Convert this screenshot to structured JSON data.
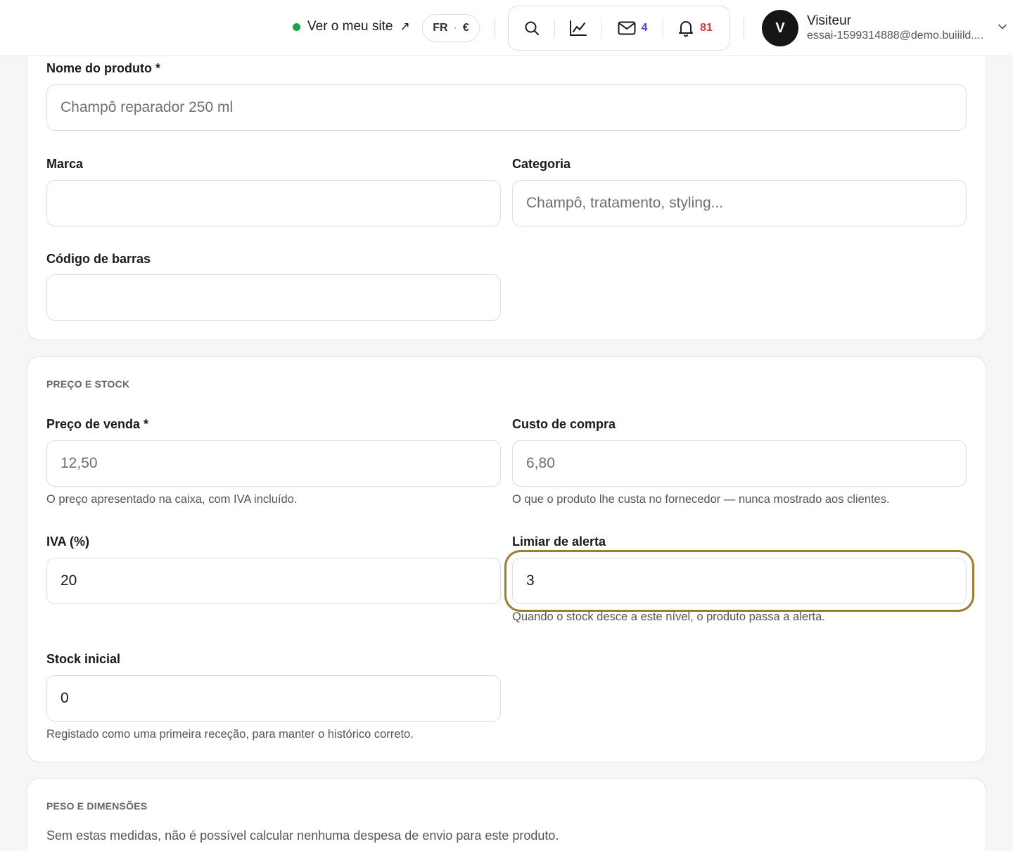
{
  "topbar": {
    "site_link_label": "Ver o meu site",
    "site_link_arrow": "↗",
    "lang": "FR",
    "lang_sep": "·",
    "currency": "€",
    "messages_count": "4",
    "notifications_count": "81",
    "user": {
      "initial": "V",
      "name": "Visiteur",
      "email": "essai-1599314888@demo.buiiild...."
    },
    "icons": [
      "search-icon",
      "chart-icon",
      "mail-icon",
      "bell-icon",
      "chevron-down-icon"
    ]
  },
  "product": {
    "name": {
      "label": "Nome do produto *",
      "placeholder": "Champô reparador 250 ml",
      "value": ""
    },
    "brand": {
      "label": "Marca",
      "placeholder": "",
      "value": ""
    },
    "category": {
      "label": "Categoria",
      "placeholder": "Champô, tratamento, styling...",
      "value": ""
    },
    "barcode": {
      "label": "Código de barras",
      "placeholder": "",
      "value": ""
    }
  },
  "pricing": {
    "section_title": "PREÇO E STOCK",
    "sale_price": {
      "label": "Preço de venda *",
      "placeholder": "12,50",
      "value": "",
      "help": "O preço apresentado na caixa, com IVA incluído."
    },
    "purchase_cost": {
      "label": "Custo de compra",
      "placeholder": "6,80",
      "value": "",
      "help": "O que o produto lhe custa no fornecedor — nunca mostrado aos clientes."
    },
    "vat": {
      "label": "IVA (%)",
      "value": "20"
    },
    "alert_threshold": {
      "label": "Limiar de alerta",
      "value": "3",
      "help": "Quando o stock desce a este nível, o produto passa a alerta."
    },
    "initial_stock": {
      "label": "Stock inicial",
      "value": "0",
      "help": "Registado como uma primeira receção, para manter o histórico correto."
    }
  },
  "dimensions": {
    "section_title": "PESO E DIMENSÕES",
    "description": "Sem estas medidas, não é possível calcular nenhuma despesa de envio para este produto."
  },
  "colors": {
    "accent_focus": "#a07c2e",
    "live_dot": "#22a34a",
    "badge_messages": "#3f46d6",
    "badge_notifications": "#d63a3a"
  }
}
